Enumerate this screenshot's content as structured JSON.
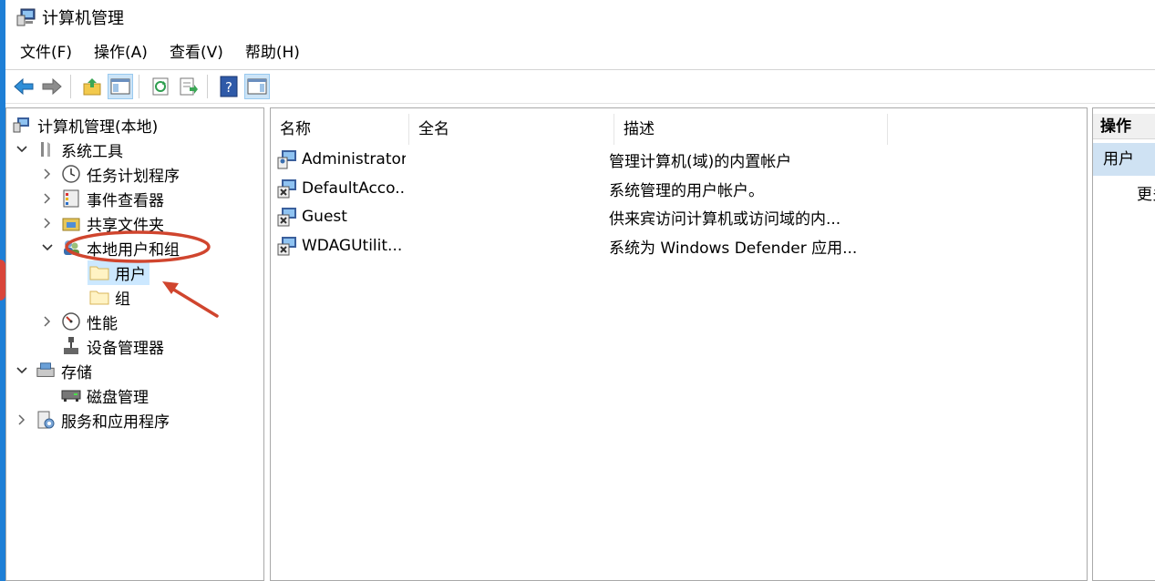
{
  "window": {
    "title": "计算机管理"
  },
  "menu": {
    "file": "文件(F)",
    "action": "操作(A)",
    "view": "查看(V)",
    "help": "帮助(H)"
  },
  "tree": {
    "root": "计算机管理(本地)",
    "system_tools": "系统工具",
    "task_scheduler": "任务计划程序",
    "event_viewer": "事件查看器",
    "shared_folders": "共享文件夹",
    "local_users_groups": "本地用户和组",
    "users": "用户",
    "groups": "组",
    "performance": "性能",
    "device_manager": "设备管理器",
    "storage": "存储",
    "disk_management": "磁盘管理",
    "services_apps": "服务和应用程序"
  },
  "list": {
    "columns": {
      "name": "名称",
      "full_name": "全名",
      "description": "描述"
    },
    "rows": [
      {
        "name": "Administrator",
        "full_name": "",
        "description": "管理计算机(域)的内置帐户"
      },
      {
        "name": "DefaultAcco...",
        "full_name": "",
        "description": "系统管理的用户帐户。"
      },
      {
        "name": "Guest",
        "full_name": "",
        "description": "供来宾访问计算机或访问域的内..."
      },
      {
        "name": "WDAGUtilit...",
        "full_name": "",
        "description": "系统为 Windows Defender 应用..."
      }
    ]
  },
  "actions": {
    "header": "操作",
    "selected": "用户",
    "more": "更多"
  },
  "colors": {
    "selection": "#cce8ff",
    "annotation": "#d0452e",
    "taskbar": "#1e7fd6"
  }
}
